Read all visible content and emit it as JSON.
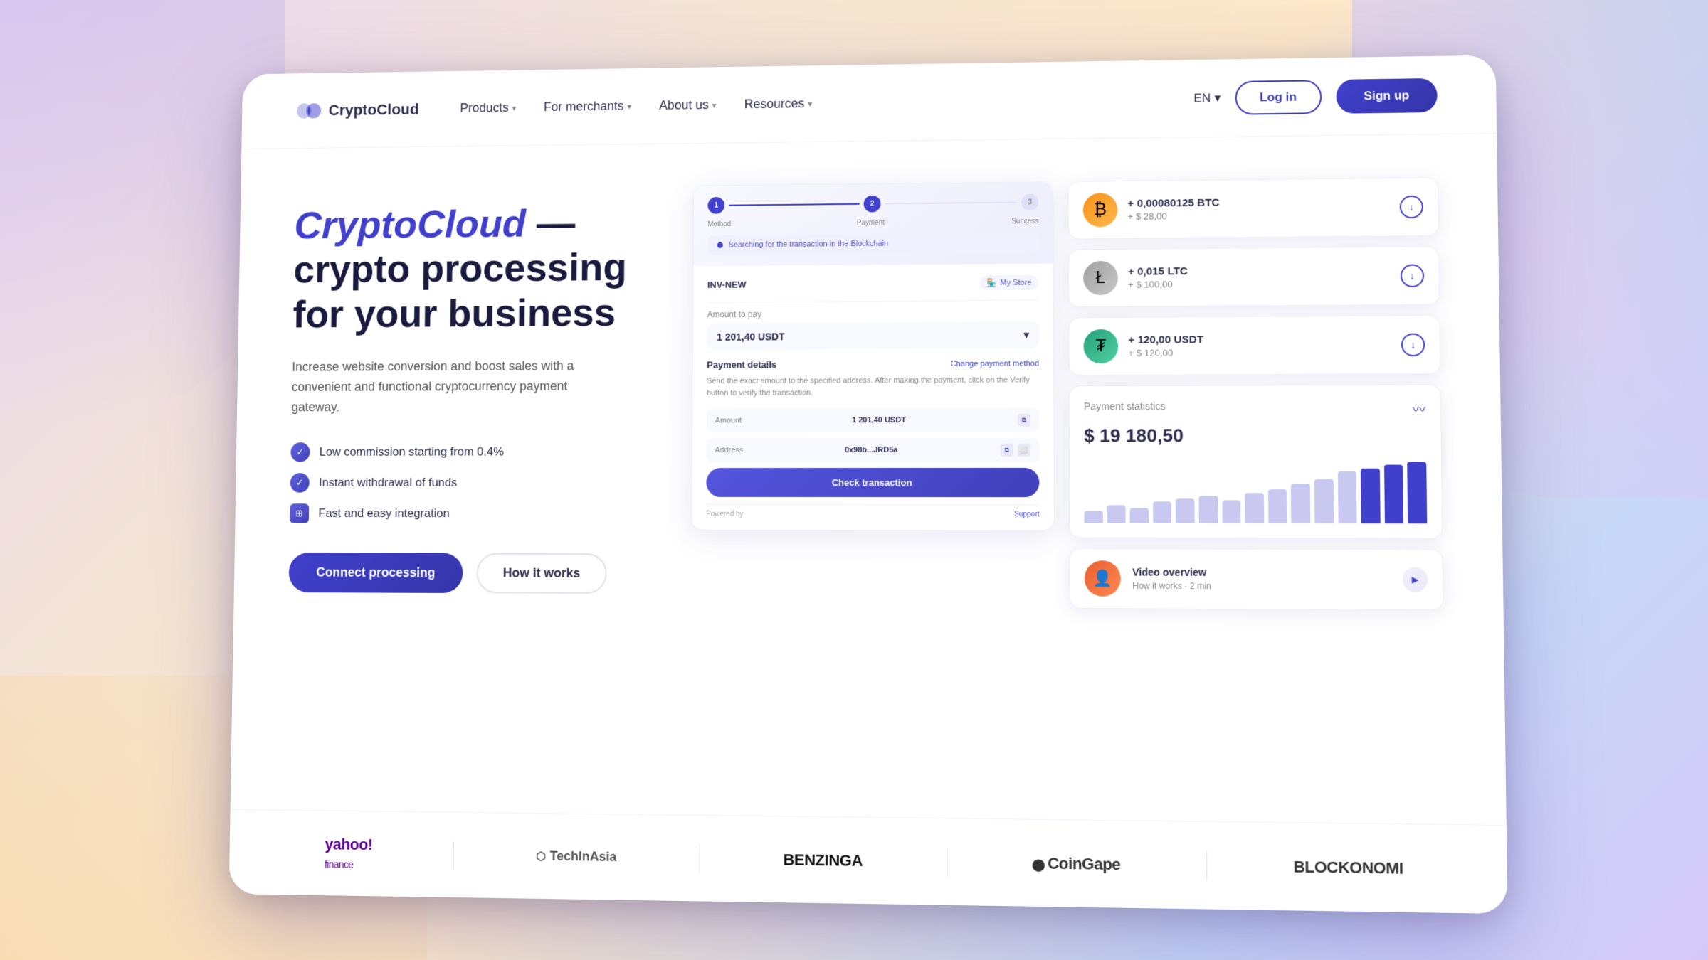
{
  "background": {
    "gradient": "linear-gradient(135deg, #e8d5f5 0%, #f5e6d3 30%, #fde8c8 50%, #c8d8f8 80%, #d5c8f8 100%)"
  },
  "navbar": {
    "logo_text": "CryptoCloud",
    "nav_items": [
      {
        "label": "Products",
        "has_dropdown": true
      },
      {
        "label": "For merchants",
        "has_dropdown": true
      },
      {
        "label": "About us",
        "has_dropdown": true
      },
      {
        "label": "Resources",
        "has_dropdown": true
      }
    ],
    "lang": "EN",
    "login_label": "Log in",
    "signup_label": "Sign up"
  },
  "hero": {
    "title_brand": "CryptoCloud",
    "title_rest": " — crypto processing for your business",
    "subtitle": "Increase website conversion and boost sales with a convenient and functional cryptocurrency payment gateway.",
    "features": [
      {
        "text": "Low commission starting from 0.4%"
      },
      {
        "text": "Instant withdrawal of funds"
      },
      {
        "text": "Fast and easy integration"
      }
    ],
    "btn_connect": "Connect processing",
    "btn_how": "How it works"
  },
  "payment_card": {
    "steps": [
      "Method",
      "Payment",
      "Success"
    ],
    "searching_text": "Searching for the transaction in the Blockchain",
    "invoice_label": "INV-NEW",
    "store_label": "My Store",
    "amount_label": "Amount to pay",
    "amount_value": "1 201,40 USDT",
    "payment_details_title": "Payment details",
    "payment_details_link": "Change payment method",
    "payment_details_text": "Send the exact amount to the specified address. After making the payment, click on the Verify button to verify the transaction.",
    "amount_label2": "Amount",
    "amount_value2": "1 201,40 USDT",
    "address_label": "Address",
    "address_value": "0x98b...JRD5a",
    "check_btn": "Check transaction",
    "footer_powered": "Powered by",
    "footer_support": "Support"
  },
  "crypto_transactions": [
    {
      "icon": "₿",
      "icon_type": "btc",
      "amount": "+ 0,00080125 BTC",
      "usd": "+ $ 28,00"
    },
    {
      "icon": "Ł",
      "icon_type": "ltc",
      "amount": "+ 0,015 LTC",
      "usd": "+ $ 100,00"
    },
    {
      "icon": "T",
      "icon_type": "usdt",
      "amount": "+ 120,00 USDT",
      "usd": "+ $ 120,00"
    }
  ],
  "stats": {
    "title": "Payment statistics",
    "value": "$ 19 180,50",
    "bars": [
      20,
      30,
      25,
      35,
      40,
      45,
      38,
      50,
      55,
      65,
      72,
      85,
      90,
      95,
      100
    ]
  },
  "video": {
    "title": "Video overview",
    "subtitle": "How it works · 2 min"
  },
  "brands": [
    {
      "name": "yahoo! finance",
      "type": "yahoo"
    },
    {
      "name": "TechInAsia",
      "type": "tech"
    },
    {
      "name": "BENZINGA",
      "type": "benzinga"
    },
    {
      "name": "CoinGape",
      "type": "coingape"
    },
    {
      "name": "BLOCKONOMI",
      "type": "blockonomi"
    }
  ]
}
